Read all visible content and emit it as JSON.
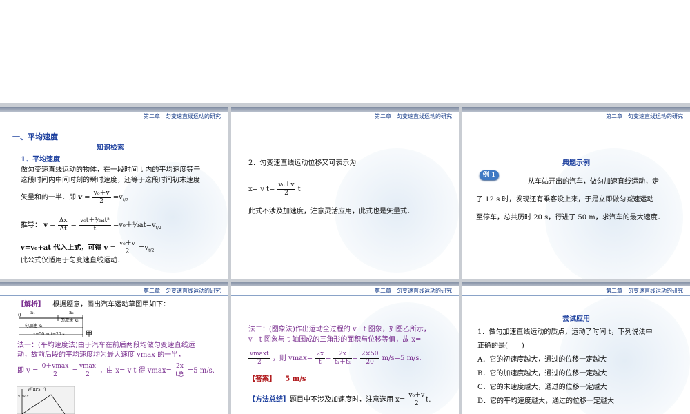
{
  "header": "第二章　匀变速直线运动的研究",
  "s1": {
    "section": "一、平均速度",
    "sub": "知识检索",
    "h1": "1．平均速度",
    "p1": "做匀变速直线运动的物体，在一段时间 t 内的平均速度等于",
    "p2": "这段时间内中间时刻的瞬时速度，还等于这段时间初末速度",
    "p3a": "矢量和的一半．即",
    "p4a": "推导：",
    "p5a": "v=v₀+at 代入上式，可得",
    "p6": "此公式仅适用于匀变速直线运动．"
  },
  "s2": {
    "l1": "2．匀变速直线运动位移又可表示为",
    "l2": "x= v t=",
    "l2b": "t",
    "l3": "此式不涉及加速度，注意灵活应用，此式也是矢量式．"
  },
  "s3": {
    "title": "典题示例",
    "badge": "例 1",
    "l1": "从车站开出的汽车，做匀加速直线运动，走",
    "l2": "了 12 s 时，发现还有乘客没上来，于是立即做匀减速运动",
    "l3": "至停车，总共历时 20 s，行进了 50 m，求汽车的最大速度．"
  },
  "s4": {
    "tag": "【解析】",
    "l1": "根据题意，画出汽车运动草图甲如下：",
    "fig": "甲",
    "l2": "法一：(平均速度法)由于汽车在前后两段均做匀变速直线运",
    "l3": "动，故前后段的平均速度均为最大速度 vmax 的一半，",
    "l4": "即 v =",
    "l4b": "，由 x= v t 得 vmax=",
    "l4c": "=5 m/s.",
    "diag": {
      "a1": "a₁",
      "a2": "a₂",
      "seg1": "匀加速 x₁",
      "seg2": "匀减速 x₂",
      "total": "x=50 m,t=20 s",
      "zero": "0",
      "yaxis": "v/(m·s⁻¹)",
      "vmax": "vmax"
    }
  },
  "s5": {
    "l1": "法二：(图象法)作出运动全过程的 v　t 图象，如图乙所示，",
    "l2": "v　t 图象与 t 轴围成的三角形的面积与位移等值，故 x=",
    "l3b": "，则 vmax=",
    "l3c": "m/s=5 m/s.",
    "ans_tag": "【答案】",
    "ans": "5 m/s",
    "sum_tag": "【方法总结】",
    "sum": "题目中不涉及加速度时，注意选用 x="
  },
  "s6": {
    "title": "尝试应用",
    "q1": "1．做匀加速直线运动的质点，运动了时间 t，下列说法中",
    "q2": "正确的是(　　)",
    "A": "A．它的初速度越大，通过的位移一定越大",
    "B": "B．它的加速度越大，通过的位移一定越大",
    "C": "C．它的末速度越大，通过的位移一定越大",
    "D": "D．它的平均速度越大，通过的位移一定越大"
  }
}
